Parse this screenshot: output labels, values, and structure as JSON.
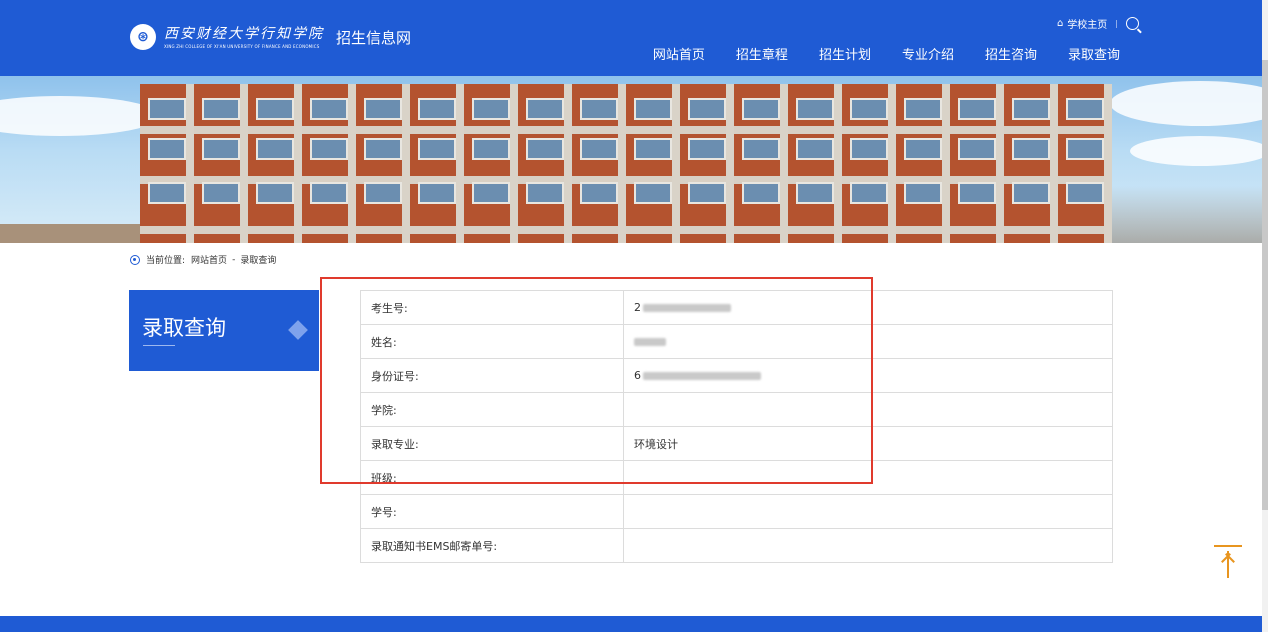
{
  "header": {
    "logo_calligraphy": "西安财经大学行知学院",
    "logo_english": "XING ZHI COLLEGE OF XI'AN UNIVERSITY OF FINANCE AND ECONOMICS",
    "site_name": "招生信息网",
    "school_home_label": "学校主页",
    "nav": [
      "网站首页",
      "招生章程",
      "招生计划",
      "专业介绍",
      "招生咨询",
      "录取查询"
    ],
    "brand_color": "#1f5bd4"
  },
  "breadcrumb": {
    "prefix": "当前位置:",
    "items": [
      "网站首页",
      "录取查询"
    ],
    "separator": "-"
  },
  "side_title": "录取查询",
  "table": {
    "rows": [
      {
        "label": "考生号:",
        "value": "2",
        "blurred": true
      },
      {
        "label": "姓名:",
        "value": "",
        "blurred": true
      },
      {
        "label": "身份证号:",
        "value": "6",
        "blurred": true
      },
      {
        "label": "学院:",
        "value": "",
        "blurred": false
      },
      {
        "label": "录取专业:",
        "value": "环境设计",
        "blurred": false
      },
      {
        "label": "班级:",
        "value": "",
        "blurred": false
      },
      {
        "label": "学号:",
        "value": "",
        "blurred": false
      },
      {
        "label": "录取通知书EMS邮寄单号:",
        "value": "",
        "blurred": false
      }
    ]
  },
  "accent_colors": {
    "highlight": "#e03a2d",
    "back_to_top": "#e8951f"
  }
}
